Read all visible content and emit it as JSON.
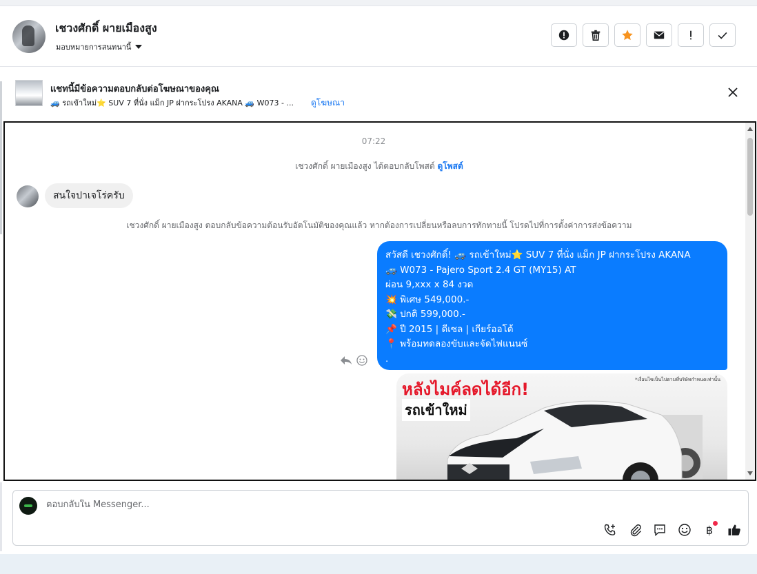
{
  "header": {
    "name": "เชวงศักดิ์ ผายเมืองสูง",
    "assign_label": "มอบหมายการสนทนานี้",
    "actions": [
      "spam-icon",
      "trash-icon",
      "star-icon",
      "envelope-icon",
      "exclamation-icon",
      "check-icon"
    ],
    "star_color": "#f7931e"
  },
  "ad_bar": {
    "title": "แชทนี้มีข้อความตอบกลับต่อโฆษณาของคุณ",
    "subtitle": "🚙 รถเข้าใหม่⭐ SUV 7 ที่นั่ง แม็ก JP ฝากระโปรง AKANA 🚙 W073 - ...",
    "link": "ดูโฆษณา"
  },
  "conversation": {
    "time": "07:22",
    "post_reply_text": "เชวงศักดิ์ ผายเมืองสูง ได้ตอบกลับโพสต์",
    "post_reply_link": "ดูโพสต์",
    "incoming_message": "สนใจปาเจโร่ครับ",
    "auto_reply_notice": "เชวงศักดิ์ ผายเมืองสูง ตอบกลับข้อความต้อนรับอัตโนมัติของคุณแล้ว หากต้องการเปลี่ยนหรือลบการทักทายนี้ โปรดไปที่การตั้งค่าการส่งข้อความ",
    "outgoing_lines": [
      "สวัสดี เชวงศักดิ์! 🚙 รถเข้าใหม่⭐ SUV 7 ที่นั่ง แม็ก JP ฝากระโปรง AKANA",
      "🚙 W073 - Pajero Sport 2.4 GT (MY15) AT",
      "ผ่อน 9,xxx x 84 งวด",
      "💥 พิเศษ 549,000.-",
      "💸 ปกติ 599,000.-",
      "📌 ปี 2015 | ดีเซล | เกียร์ออโต้",
      "📍 พร้อมทดลองขับและจัดไฟแนนซ์",
      "."
    ],
    "image_card": {
      "headline": "หลังไมค์ลดได้อีก!",
      "subhead": "รถเข้าใหม่",
      "note": "*เงื่อนไขเป็นไปตามที่บริษัทกำหนดเท่านั้น"
    },
    "bubble_color": "#0a7cff"
  },
  "composer": {
    "placeholder": "ตอบกลับใน Messenger...",
    "tools": [
      "phone-add-icon",
      "attachment-icon",
      "saved-reply-icon",
      "emoji-icon",
      "baht-icon",
      "thumbs-up-icon"
    ],
    "baht_symbol": "฿"
  }
}
